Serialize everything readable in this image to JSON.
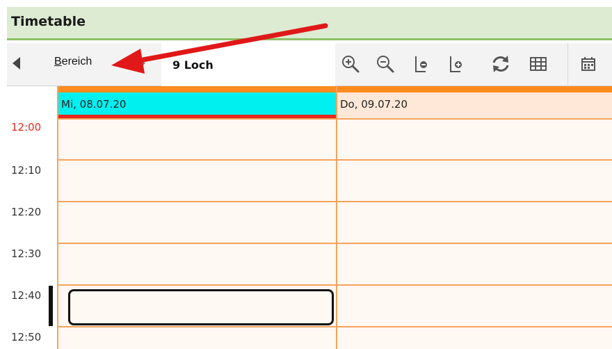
{
  "window": {
    "title": "Timetable"
  },
  "toolbar": {
    "area_label_underlined": "B",
    "area_label_rest": "ereich",
    "selected_value": "9 Loch",
    "icons": [
      "zoom-in-icon",
      "zoom-out-icon",
      "remove-column-icon",
      "add-column-icon",
      "refresh-icon",
      "table-view-icon",
      "calendar-icon"
    ]
  },
  "calendar": {
    "days": [
      {
        "label": "Mi, 08.07.20",
        "highlighted": true
      },
      {
        "label": "Do, 09.07.20",
        "highlighted": false
      }
    ],
    "times": [
      "12:00",
      "12:10",
      "12:20",
      "12:30",
      "12:40",
      "12:50"
    ],
    "current_time": "12:00"
  },
  "colors": {
    "title_bg": "#dcebd2",
    "title_border": "#8cc063",
    "accent_orange": "#ff8a1e",
    "today_header": "#00f0f0",
    "now_red": "#e8281e",
    "cell_bg": "#fff8f3",
    "grid_line": "#f5a35c"
  }
}
